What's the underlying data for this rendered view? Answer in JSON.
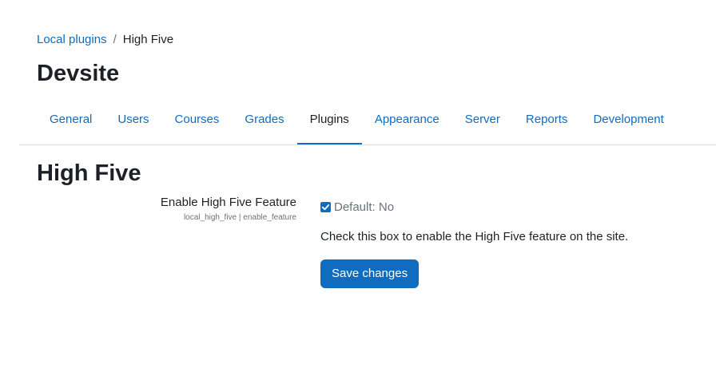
{
  "breadcrumb": {
    "parent": "Local plugins",
    "separator": "/",
    "current": "High Five"
  },
  "site_title": "Devsite",
  "tabs": [
    {
      "label": "General",
      "active": false
    },
    {
      "label": "Users",
      "active": false
    },
    {
      "label": "Courses",
      "active": false
    },
    {
      "label": "Grades",
      "active": false
    },
    {
      "label": "Plugins",
      "active": true
    },
    {
      "label": "Appearance",
      "active": false
    },
    {
      "label": "Server",
      "active": false
    },
    {
      "label": "Reports",
      "active": false
    },
    {
      "label": "Development",
      "active": false
    }
  ],
  "section_title": "High Five",
  "setting": {
    "label": "Enable High Five Feature",
    "identifier": "local_high_five | enable_feature",
    "checked": true,
    "default_text": "Default: No",
    "description": "Check this box to enable the High Five feature on the site."
  },
  "save_button": {
    "label": "Save changes"
  },
  "colors": {
    "accent": "#0f6cbf",
    "text": "#1d2125",
    "muted": "#6a737b"
  }
}
